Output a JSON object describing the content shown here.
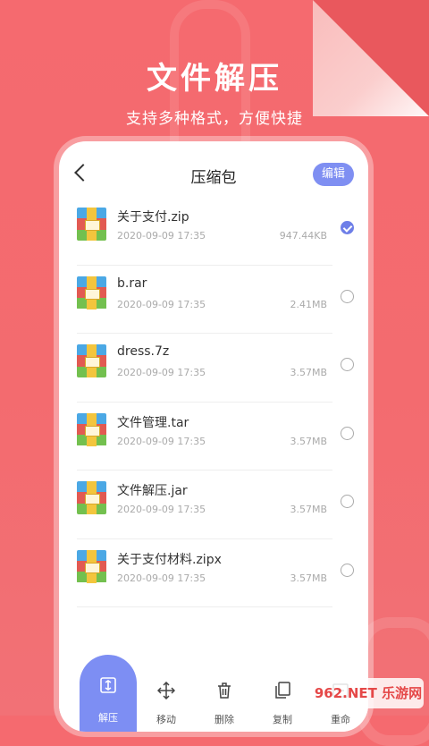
{
  "hero": {
    "title": "文件解压",
    "subtitle": "支持多种格式，方便快捷"
  },
  "app": {
    "page_title": "压缩包",
    "edit_label": "编辑"
  },
  "files": [
    {
      "name": "关于支付.zip",
      "date": "2020-09-09 17:35",
      "size": "947.44KB",
      "selected": true
    },
    {
      "name": "b.rar",
      "date": "2020-09-09 17:35",
      "size": "2.41MB",
      "selected": false
    },
    {
      "name": "dress.7z",
      "date": "2020-09-09 17:35",
      "size": "3.57MB",
      "selected": false
    },
    {
      "name": "文件管理.tar",
      "date": "2020-09-09 17:35",
      "size": "3.57MB",
      "selected": false
    },
    {
      "name": "文件解压.jar",
      "date": "2020-09-09 17:35",
      "size": "3.57MB",
      "selected": false
    },
    {
      "name": "关于支付材料.zipx",
      "date": "2020-09-09 17:35",
      "size": "3.57MB",
      "selected": false
    }
  ],
  "toolbar": {
    "items": [
      {
        "label": "解压",
        "icon": "extract-icon",
        "active": true
      },
      {
        "label": "移动",
        "icon": "move-icon",
        "active": false
      },
      {
        "label": "删除",
        "icon": "trash-icon",
        "active": false
      },
      {
        "label": "复制",
        "icon": "copy-icon",
        "active": false
      },
      {
        "label": "重命",
        "icon": "rename-icon",
        "active": false
      }
    ]
  },
  "watermark": "962.NET 乐游网",
  "colors": {
    "background": "#f56a6f",
    "accent": "#7d8ef3"
  }
}
